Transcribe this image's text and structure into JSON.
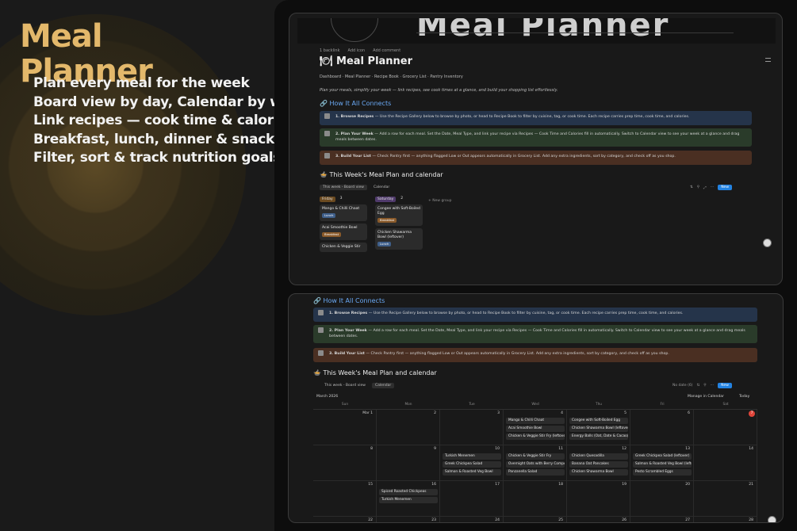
{
  "hero": {
    "title_line1": "Meal",
    "title_line2": "Planner",
    "bullets": [
      "Plan every meal for the week",
      "Board view by day, Calendar by week",
      "Link recipes — cook time & calories auto-fill",
      "Breakfast, lunch, dinner & snacks",
      "Filter, sort & track nutrition goals"
    ]
  },
  "colors": {
    "accent": "#e3b86b",
    "link": "#6aa9f5",
    "new": "#2383e2"
  },
  "page": {
    "cover_title": "Meal Planner",
    "toolbar": [
      "1 backlink",
      "Add icon",
      "Add comment"
    ],
    "icon": "plate-icon",
    "title": "Meal Planner",
    "breadcrumb": "Dashboard · Meal Planner · Recipe Book · Grocery List · Pantry Inventory",
    "intro": "Plan your meals, simplify your week — link recipes, see cook times at a glance, and build your shopping list effortlessly.",
    "how_heading": "How It All Connects",
    "steps": [
      {
        "label": "1. Browse Recipes",
        "text": " — Use the Recipe Gallery below to browse by photo, or head to Recipe Book to filter by cuisine, tag, or cook time. Each recipe carries prep time, cook time, and calories."
      },
      {
        "label": "2. Plan Your Week",
        "text": " — Add a row for each meal. Set the Date, Meal Type, and link your recipe via Recipes — Cook Time and Calories fill in automatically. Switch to Calendar view to see your week at a glance and drag meals between dates."
      },
      {
        "label": "3. Build Your List",
        "text": " — Check Pantry first — anything flagged Low or Out appears automatically in Grocery List. Add any extra ingredients, sort by category, and check off as you shop."
      }
    ],
    "week_heading": "This Week's Meal Plan and calendar",
    "views": [
      "This week - Board view",
      "Calendar"
    ],
    "tools": [
      "⇅",
      "⚲",
      "⤢",
      "⋯"
    ],
    "new_label": "New",
    "new_group": "+ New group"
  },
  "board": [
    {
      "day": "Friday",
      "count": "3",
      "cards": [
        {
          "name": "Mango & Chilli Chaat",
          "type": "Lunch"
        },
        {
          "name": "Acai Smoothie Bowl",
          "type": "Breakfast"
        },
        {
          "name": "Chicken & Veggie Stir",
          "type": ""
        }
      ]
    },
    {
      "day": "Saturday",
      "count": "2",
      "cards": [
        {
          "name": "Congee with Soft-Boiled Egg",
          "type": "Breakfast"
        },
        {
          "name": "Chicken Shawarma Bowl (leftover)",
          "type": "Lunch"
        }
      ]
    }
  ],
  "calendar": {
    "views": [
      "This week - Board view",
      "Calendar"
    ],
    "month": "March 2026",
    "no_date": "No date (6)",
    "manage": "Manage in Calendar",
    "today_label": "Today",
    "weekdays": [
      "Sun",
      "Mon",
      "Tue",
      "Wed",
      "Thu",
      "Fri",
      "Sat"
    ],
    "weeks": [
      {
        "days": [
          "Mar 1",
          "2",
          "3",
          "4",
          "5",
          "6",
          "7"
        ],
        "events": {
          "3": [
            "Mango & Chilli Chaat",
            "Acai Smoothie Bowl",
            "Chicken & Veggie Stir Fry (leftover)"
          ],
          "4": [
            "Congee with Soft-Boiled Egg",
            "Chicken Shawarma Bowl (leftover)",
            "Energy Balls (Oat, Date & Cacao)"
          ]
        }
      },
      {
        "days": [
          "8",
          "9",
          "10",
          "11",
          "12",
          "13",
          "14"
        ],
        "events": {
          "2": [
            "Turkish Menemen",
            "Greek Chickpea Salad",
            "Salmon & Roasted Veg Bowl"
          ],
          "3": [
            "Chicken & Veggie Stir Fry",
            "Overnight Oats with Berry Compote",
            "Panzanella Salad"
          ],
          "4": [
            "Chicken Quesadilla",
            "Banana Oat Pancakes",
            "Chicken Shawarma Bowl"
          ],
          "5": [
            "Greek Chickpea Salad (leftover)",
            "Salmon & Roasted Veg Bowl (leftover)",
            "Pesto Scrambled Eggs"
          ]
        }
      },
      {
        "days": [
          "15",
          "16",
          "17",
          "18",
          "19",
          "20",
          "21"
        ],
        "events": {
          "1": [
            "Spiced Roasted Chickpeas",
            "Turkish Menemen"
          ]
        }
      },
      {
        "days": [
          "22",
          "23",
          "24",
          "25",
          "26",
          "27",
          "28"
        ],
        "events": {}
      }
    ],
    "today_index": "6"
  }
}
